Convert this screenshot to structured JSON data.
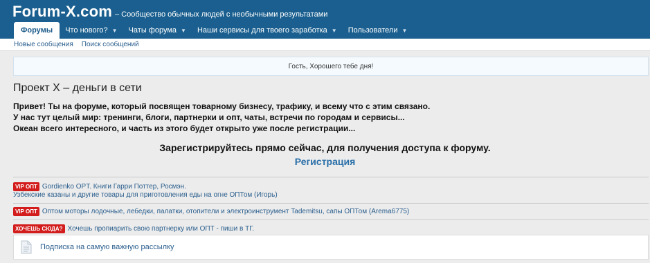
{
  "header": {
    "logo": "Forum-X.com",
    "tagline": "– Сообщество обычных людей с необычными результатами"
  },
  "nav": {
    "tabs": [
      {
        "label": "Форумы",
        "active": true
      },
      {
        "label": "Что нового?",
        "dropdown": true
      },
      {
        "label": "Чаты форума",
        "dropdown": true
      },
      {
        "label": "Наши сервисы для твоего заработка",
        "dropdown": true
      },
      {
        "label": "Пользователи",
        "dropdown": true
      }
    ]
  },
  "subnav": {
    "links": [
      "Новые сообщения",
      "Поиск сообщений"
    ]
  },
  "notice": {
    "text": "Гость, Хорошего тебе дня!"
  },
  "page": {
    "title": "Проект X – деньги в сети",
    "intro": [
      "Привет! Ты на форуме, который посвящен товарному бизнесу, трафику, и всему что с этим связано.",
      "У нас тут целый мир: тренинги, блоги, партнерки и опт, чаты, встречи по городам и сервисы...",
      "Океан всего интересного, и часть из этого будет открыто уже после регистрации..."
    ],
    "cta": "Зарегистрируйтесь прямо сейчас, для получения доступа к форуму.",
    "register_label": "Регистрация"
  },
  "ads": [
    {
      "badge": "VIP ОПТ",
      "text": "Gordienko OPT. Книги Гарри Поттер, Росмэн.",
      "line2": "Узбекские казаны и другие товары для приготовления еды на огне ОПТом (Игорь)"
    },
    {
      "badge": "VIP ОПТ",
      "text": "Оптом моторы лодочные, лебедки, палатки, отопители и электроинструмент Tademitsu, сапы ОПТом (Arema6775)"
    },
    {
      "badge": "ХОЧЕШЬ СЮДА?",
      "text": "Хочешь пропиарить свою партнерку или ОПТ - пиши в ТГ."
    }
  ],
  "subscribe": {
    "text": "Подписка на самую важную рассылку",
    "icon": "document-icon"
  },
  "colors": {
    "header_bg": "#1a5f8f",
    "link": "#2a5e8d",
    "badge": "#d31c1c",
    "register": "#2a6fa8"
  }
}
